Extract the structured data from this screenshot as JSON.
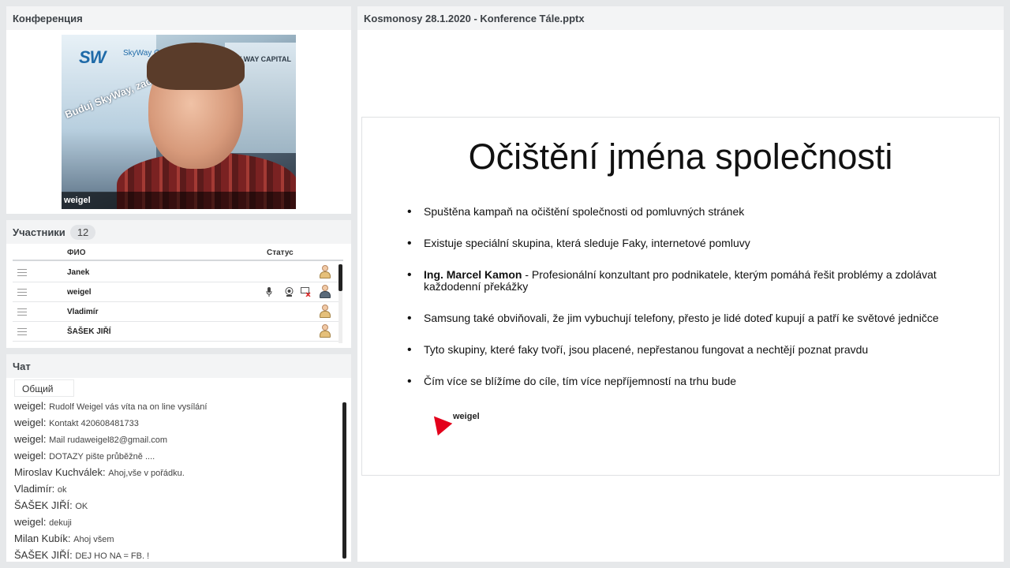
{
  "conference": {
    "title": "Конференция",
    "video_label": "weigel",
    "banner_logo": "SW",
    "banner_text": "SkyWay Capital",
    "banner_right": "SKY WAY CAPITAL",
    "banner_slogan": "Buduj SkyWay, zachraň planetu!"
  },
  "participants": {
    "title": "Участники",
    "count": "12",
    "col_name": "ФИО",
    "col_status": "Статус",
    "rows": [
      {
        "name": "Janek"
      },
      {
        "name": "weigel"
      },
      {
        "name": "Vladimír"
      },
      {
        "name": "ŠAŠEK JIŘÍ"
      }
    ]
  },
  "chat": {
    "title": "Чат",
    "tab": "Общий",
    "messages": [
      {
        "who": "weigel:",
        "text": "Rudolf Weigel vás víta na on line vysílání"
      },
      {
        "who": "weigel:",
        "text": "Kontakt 420608481733"
      },
      {
        "who": "weigel:",
        "text": "Mail rudaweigel82@gmail.com"
      },
      {
        "who": "weigel:",
        "text": "DOTAZY pište průběžně ...."
      },
      {
        "who": "Miroslav  Kuchválek:",
        "text": "Ahoj,vše v pořádku."
      },
      {
        "who": "Vladimír:",
        "text": "ok"
      },
      {
        "who": "ŠAŠEK JIŘÍ:",
        "text": "OK"
      },
      {
        "who": "weigel:",
        "text": "dekuji"
      },
      {
        "who": "Milan Kubík:",
        "text": "Ahoj všem"
      },
      {
        "who": "ŠAŠEK JIŘÍ:",
        "text": "DEJ HO NA = FB. !"
      }
    ]
  },
  "presentation": {
    "title": "Kosmonosy 28.1.2020 - Konference Tále.pptx",
    "slide_title": "Očištění jména společnosti",
    "bullets": [
      {
        "bold": "",
        "text": "Spuštěna kampaň na očištění společnosti od pomluvných  stránek"
      },
      {
        "bold": "",
        "text": "Existuje speciální skupina,  která sleduje Faky,  internetové  pomluvy"
      },
      {
        "bold": "Ing. Marcel Kamon",
        "text": " - Profesionální  konzultant  pro podnikatele,  kterým pomáhá řešit problémy a zdolávat každodenní  překážky"
      },
      {
        "bold": "",
        "text": "Samsung také obviňovali,  že jim vybuchují  telefony, přesto je lidé doteď kupují a patří ke světové jedničce"
      },
      {
        "bold": "",
        "text": "Tyto skupiny,  které faky tvoří, jsou placené, nepřestanou  fungovat a nechtějí poznat pravdu"
      },
      {
        "bold": "",
        "text": "Čím více se blížíme do cíle, tím více nepříjemností na trhu bude"
      }
    ],
    "pointer_label": "weigel",
    "pointer_color": "#e3001b"
  }
}
